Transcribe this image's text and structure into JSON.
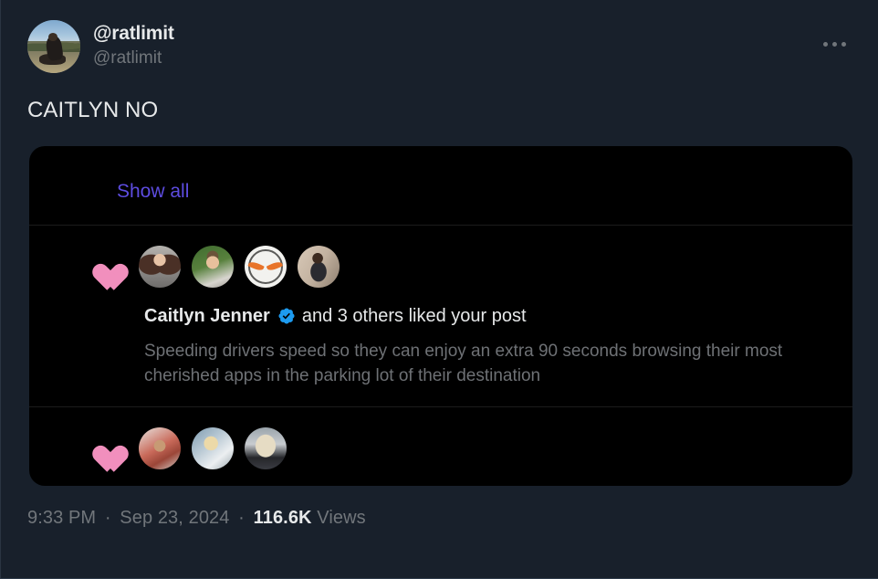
{
  "tweet": {
    "display_name": "@ratlimit",
    "handle": "@ratlimit",
    "avatar_alt": "person-riding-motorcycle-in-desert-landscape",
    "text": "CAITLYN NO",
    "more_menu": "more-options",
    "timestamp_time": "9:33 PM",
    "timestamp_date": "Sep 23, 2024",
    "views_count": "116.6K",
    "views_label": "Views",
    "separator": "·"
  },
  "media_card": {
    "clipped_top_text": "",
    "show_all_label": "Show all",
    "notifications": [
      {
        "icon": "heart-icon",
        "likers": [
          "liker-avatar-woman-long-hair",
          "liker-avatar-man-beard-greenery",
          "liker-avatar-bike-wheel-logo",
          "liker-avatar-woman-sunglasses"
        ],
        "actor": "Caitlyn Jenner",
        "verified": true,
        "action_text": "and 3 others liked your post",
        "preview": "Speeding drivers speed so they can enjoy an extra 90 seconds browsing their most cherished apps in the parking lot of their destination"
      },
      {
        "icon": "heart-icon",
        "likers": [
          "liker-avatar-man-sunglasses-red",
          "liker-avatar-blonde-woman-car",
          "liker-avatar-dog-in-suit"
        ],
        "actor": "",
        "verified": false,
        "action_text": "",
        "preview": ""
      }
    ]
  },
  "colors": {
    "page_background": "#18202b",
    "card_background": "#000000",
    "primary_text": "#e7e9ea",
    "secondary_text": "#71767b",
    "preview_text": "#6e7175",
    "show_all_link": "#5d4ce0",
    "heart_pink": "#f18fbd",
    "verified_blue": "#1d9bf0",
    "divider": "#1b1b1b"
  }
}
